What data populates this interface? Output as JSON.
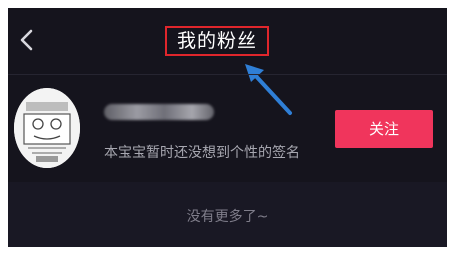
{
  "header": {
    "title": "我的粉丝",
    "back_icon": "chevron-left-icon"
  },
  "follower": {
    "name": "",
    "signature": "本宝宝暂时还没想到个性的签名",
    "follow_label": "关注"
  },
  "list": {
    "end_text": "没有更多了~"
  },
  "colors": {
    "background": "#15141d",
    "follow_button": "#f0355c",
    "annotation_box": "#e0262c",
    "annotation_arrow": "#2f7fd6"
  }
}
